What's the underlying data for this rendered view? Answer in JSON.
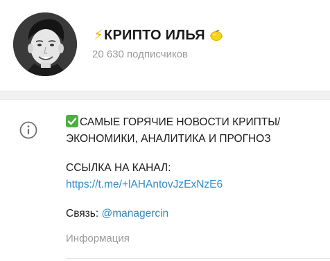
{
  "channel": {
    "title_prefix_glyph": "⚡",
    "title": "КРИПТО ИЛЬЯ",
    "title_suffix_icon": "lemon-icon",
    "subscribers": "20 630 подписчиков"
  },
  "info": {
    "icon": "info-icon",
    "description_line1": "САМЫЕ ГОРЯЧИЕ НОВОСТИ КРИПТЫ/",
    "description_line2": "ЭКОНОМИКИ, АНАЛИТИКА И ПРОГНОЗ",
    "description_icon": "checkmark-icon",
    "link_heading": "ССЫЛКА НА КАНАЛ:",
    "link_url": "https://t.me/+lAHAntovJzExNzE6",
    "contact_label": "Связь:",
    "contact_handle": "@managercin",
    "caption": "Информация"
  },
  "colors": {
    "link": "#2e8bcc",
    "muted": "#9a9a9a",
    "check_bg": "#4caf3f",
    "band": "#f1f1f1"
  }
}
